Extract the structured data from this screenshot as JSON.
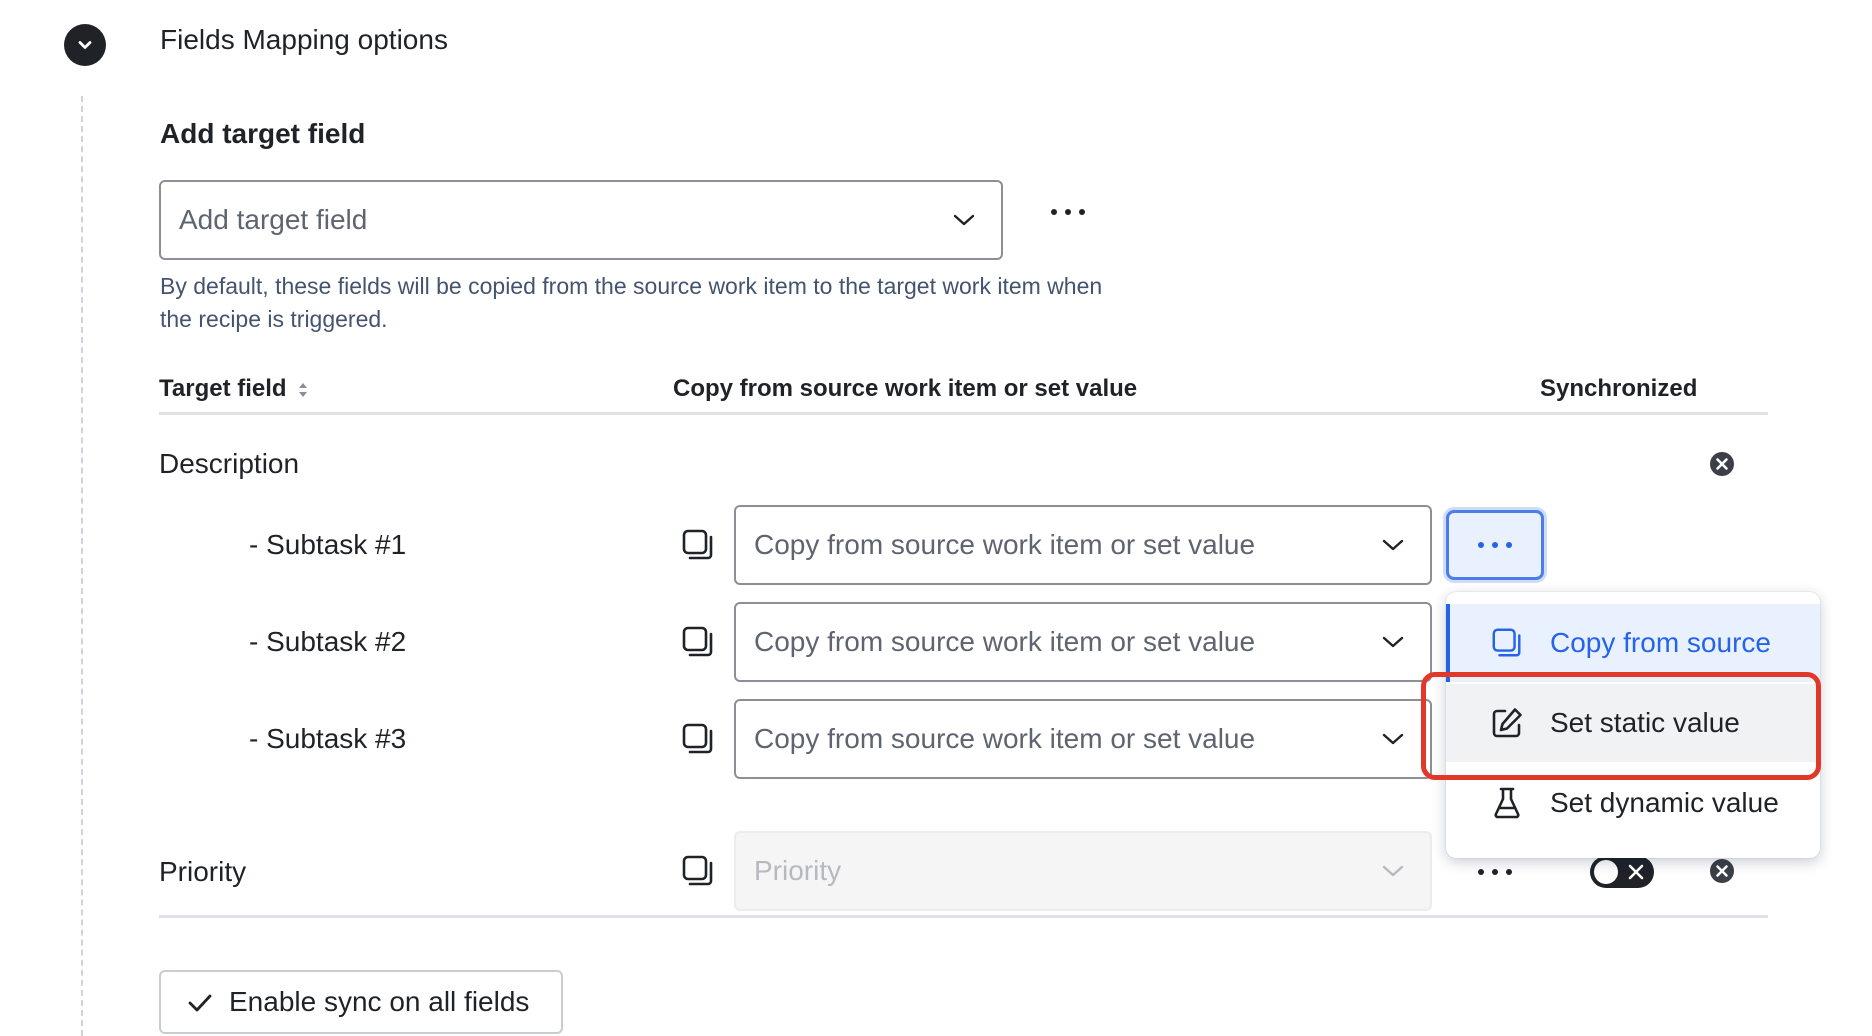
{
  "section": {
    "title": "Fields Mapping options"
  },
  "add_target": {
    "heading": "Add target field",
    "placeholder": "Add target field",
    "hint": "By default, these fields will be copied from the source work item to the target work item when the recipe is triggered."
  },
  "table": {
    "headers": {
      "target_field": "Target field",
      "copy_or_set": "Copy from source work item or set value",
      "synchronized": "Synchronized"
    },
    "rows": [
      {
        "label": "Description"
      },
      {
        "label": "- Subtask #1",
        "value": "Copy from source work item or set value"
      },
      {
        "label": "- Subtask #2",
        "value": "Copy from source work item or set value"
      },
      {
        "label": "- Subtask #3",
        "value": "Copy from source work item or set value"
      },
      {
        "label": "Priority",
        "value": "Priority",
        "disabled": true
      }
    ]
  },
  "menu": {
    "items": [
      {
        "label": "Copy from source",
        "icon": "copy-icon",
        "state": "selected"
      },
      {
        "label": "Set static value",
        "icon": "edit-icon",
        "state": "hover"
      },
      {
        "label": "Set dynamic value",
        "icon": "flask-icon",
        "state": "normal"
      }
    ]
  },
  "footer": {
    "enable_sync_label": "Enable sync on all fields"
  },
  "colors": {
    "accent": "#2563eb",
    "highlight": "#e2382a",
    "text": "#1f2328"
  }
}
